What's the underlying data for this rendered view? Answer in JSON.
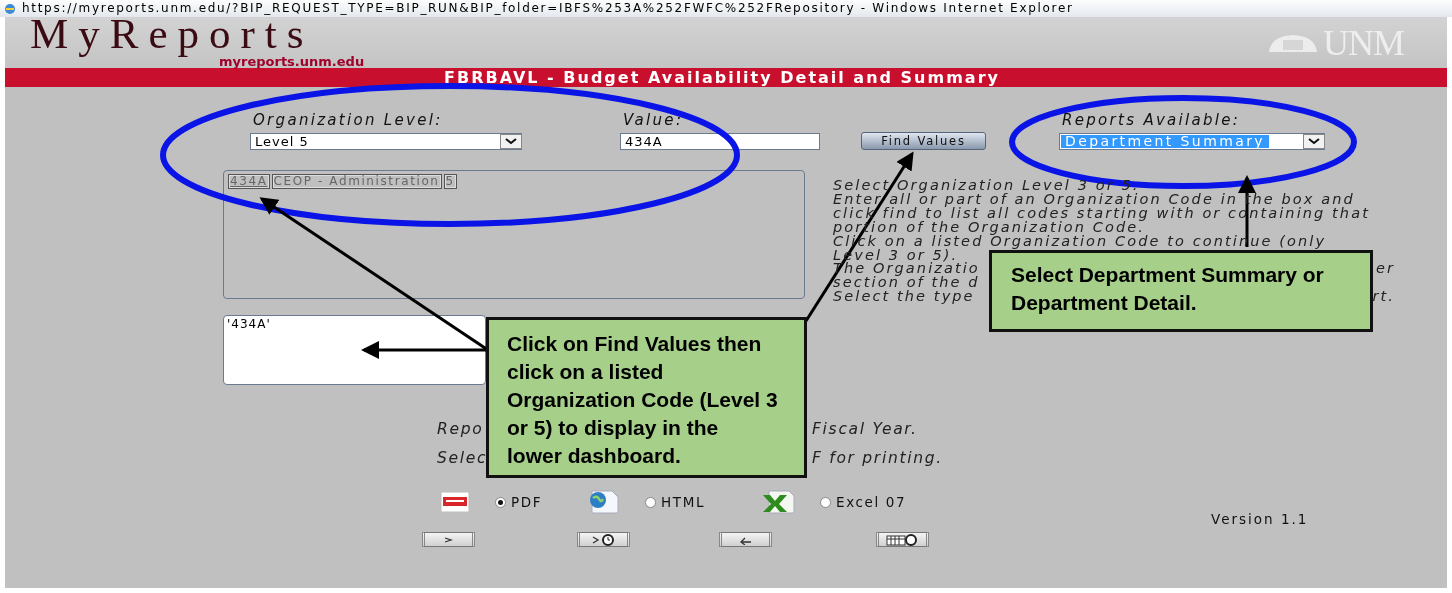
{
  "window": {
    "title": "https://myreports.unm.edu/?BIP_REQUEST_TYPE=BIP_RUN&BIP_folder=IBFS%253A%252FWFC%252FRepository - Windows Internet Explorer"
  },
  "header": {
    "logo_title": "MyReports",
    "logo_subtitle": "myreports.unm.edu",
    "brand": "UNM",
    "report_title": "FBRBAVL - Budget Availability Detail and Summary"
  },
  "form": {
    "org_level": {
      "label": "Organization Level:",
      "value": "Level 5"
    },
    "value_field": {
      "label": "Value:",
      "value": "434A"
    },
    "find_button": "Find Values",
    "reports": {
      "label": "Reports Available:",
      "value": "Department Summary"
    },
    "results": [
      {
        "code": "434A",
        "name": "CEOP - Administration",
        "level": "5"
      }
    ],
    "selection": "'434A'",
    "help_lines": [
      {
        "parts": [
          "Select Organization Level 3 or 5."
        ]
      },
      {
        "parts": [
          "Enter all or part of an Organization Code in the box and"
        ]
      },
      {
        "parts": [
          "click find to list all codes starting with or containing that"
        ]
      },
      {
        "parts": [
          "portion of the Organization Code."
        ]
      },
      {
        "parts": [
          "Click on a listed Organization Code to continue (only"
        ]
      },
      {
        "parts": [
          "Level 3 or 5)."
        ]
      },
      {
        "parts": [
          "The Organizatio",
          "er"
        ]
      },
      {
        "parts": [
          "section of the d"
        ]
      },
      {
        "parts": [
          "Select the type",
          "rt."
        ]
      }
    ],
    "notes": [
      {
        "parts": [
          "Repo",
          "Fiscal Year."
        ]
      },
      {
        "parts": [
          "Selec",
          "F for printing."
        ]
      }
    ],
    "formats": [
      {
        "kind": "pdf",
        "label": "PDF",
        "selected": true
      },
      {
        "kind": "html",
        "label": "HTML",
        "selected": false
      },
      {
        "kind": "excel",
        "label": "Excel 07",
        "selected": false
      }
    ],
    "version": "Version 1.1"
  },
  "callouts": [
    {
      "text": "Click on Find Values then click on a listed Organization Code (Level 3 or 5) to display in the lower dashboard."
    },
    {
      "text": "Select Department Summary or Department Detail."
    }
  ]
}
